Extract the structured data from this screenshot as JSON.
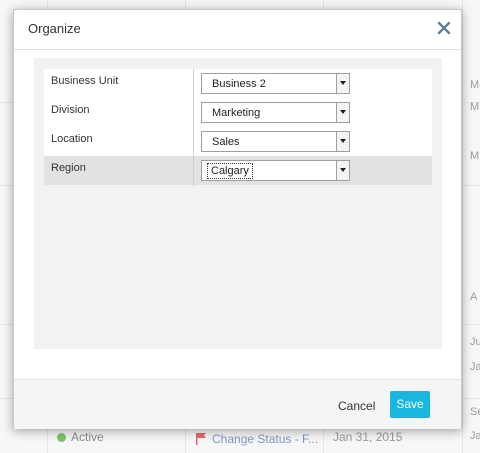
{
  "modal": {
    "title": "Organize",
    "close_icon": "close-icon"
  },
  "fields": [
    {
      "label": "Business Unit",
      "value": "Business 2"
    },
    {
      "label": "Division",
      "value": "Marketing"
    },
    {
      "label": "Location",
      "value": "Sales"
    },
    {
      "label": "Region",
      "value": "Calgary"
    }
  ],
  "footer": {
    "cancel_label": "Cancel",
    "save_label": "Save"
  },
  "background": {
    "edge_text": [
      "M",
      "M",
      "M",
      "A",
      "Ju",
      "Ja",
      "Se",
      "Ja"
    ],
    "status_text": "Active",
    "change_text": "Change Status - F...",
    "date_text": "Jan 31, 2015"
  },
  "colors": {
    "accent": "#19b7e0",
    "status_active": "#7cc66b",
    "flag": "#e46a6a",
    "link": "#7e95c8"
  }
}
